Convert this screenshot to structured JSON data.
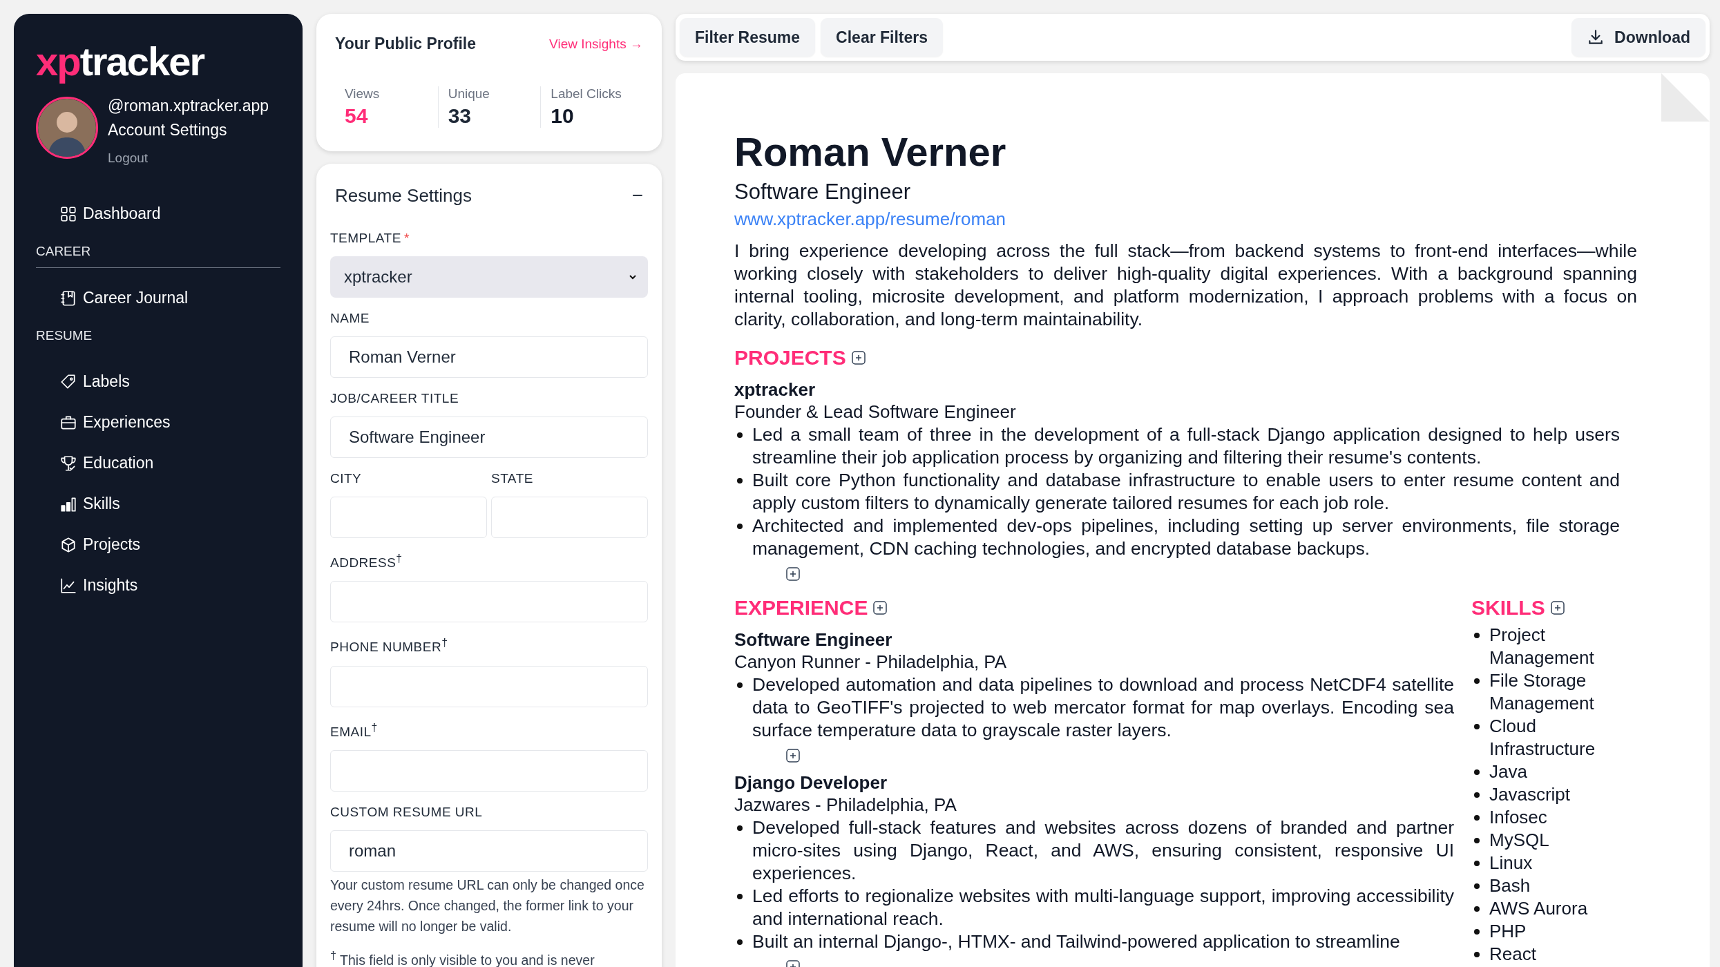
{
  "sidebar": {
    "logo": {
      "accent": "xp",
      "rest": "tracker"
    },
    "profile": {
      "handle": "@roman.xptracker.app",
      "settings_link": "Account Settings",
      "logout": "Logout"
    },
    "nav": [
      {
        "kind": "item",
        "label": "Dashboard"
      },
      {
        "kind": "heading",
        "label": "CAREER",
        "divider": true
      },
      {
        "kind": "item",
        "label": "Career Journal"
      },
      {
        "kind": "heading",
        "label": "RESUME",
        "divider": false
      },
      {
        "kind": "item",
        "label": "Labels"
      },
      {
        "kind": "item",
        "label": "Experiences"
      },
      {
        "kind": "item",
        "label": "Education"
      },
      {
        "kind": "item",
        "label": "Skills"
      },
      {
        "kind": "item",
        "label": "Projects"
      },
      {
        "kind": "item",
        "label": "Insights"
      }
    ]
  },
  "profile_card": {
    "title": "Your Public Profile",
    "link": "View Insights →",
    "stats": [
      {
        "label": "Views",
        "value": "54",
        "color": "#ff2d78"
      },
      {
        "label": "Unique",
        "value": "33",
        "color": "#1f2937"
      },
      {
        "label": "Label Clicks",
        "value": "10",
        "color": "#111827"
      }
    ]
  },
  "resume_settings": {
    "title": "Resume Settings",
    "collapse_symbol": "−",
    "required_symbol": "*",
    "fields": [
      {
        "kind": "select",
        "label": "TEMPLATE",
        "required": true,
        "value": "xptracker"
      },
      {
        "kind": "text",
        "label": "NAME",
        "required": false,
        "value": "Roman Verner"
      },
      {
        "kind": "text",
        "label": "JOB/CAREER TITLE",
        "required": false,
        "value": "Software Engineer"
      },
      {
        "kind": "pair",
        "fields": [
          {
            "label": "CITY",
            "required": false
          },
          {
            "label": "STATE",
            "required": false
          }
        ]
      },
      {
        "kind": "text",
        "label": "ADDRESS$^{†}$",
        "required": false
      },
      {
        "kind": "text",
        "label": "PHONE NUMBER$^{†}$",
        "required": false
      },
      {
        "kind": "text",
        "label": "EMAIL$^{†}$",
        "required": false
      },
      {
        "kind": "text",
        "label": "CUSTOM RESUME URL",
        "required": false,
        "value": "roman",
        "help": "Your custom resume URL can only be changed once every 24hrs. Once changed, the former link to your resume will no longer be valid."
      }
    ],
    "footnote": "$^{†}$ This field is only visible to you and is never"
  },
  "toolbar": {
    "buttons": [
      {
        "label": "Filter Resume"
      },
      {
        "label": "Clear Filters"
      }
    ],
    "download": "Download"
  },
  "resume": {
    "name": "Roman Verner",
    "title": "Software Engineer",
    "url": "www.xptracker.app/resume/roman",
    "summary": "I bring experience developing across the full stack—from backend systems to front-end interfaces—while working closely with stakeholders to deliver high-quality digital experiences. With a background spanning internal tooling, microsite development, and platform modernization, I approach problems with a focus on clarity, collaboration, and long-term maintainability.",
    "projects": {
      "heading": "PROJECTS",
      "entries": [
        {
          "name": "xptracker",
          "subtitle": "Founder & Lead Software Engineer",
          "bullets": [
            "Led a small team of three in the development of a full-stack Django application designed to help users streamline their job application process by organizing and filtering their resume's contents.",
            "Built core Python functionality and database infrastructure to enable users to enter resume content and apply custom filters to dynamically generate tailored resumes for each job role.",
            "Architected and implemented dev-ops pipelines, including setting up server environments, file storage management, CDN caching technologies, and encrypted database backups."
          ]
        }
      ]
    },
    "experience": {
      "heading": "EXPERIENCE",
      "entries": [
        {
          "name": "Software Engineer",
          "subtitle": "Canyon Runner - Philadelphia, PA",
          "bullets": [
            "Developed automation and data pipelines to download and process NetCDF4 satellite data to GeoTIFF's projected to web mercator format for map overlays. Encoding sea surface temperature data to grayscale raster layers."
          ]
        },
        {
          "name": "Django Developer",
          "subtitle": "Jazwares - Philadelphia, PA",
          "bullets": [
            "Developed full-stack features and websites across dozens of branded and partner micro-sites using Django, React, and AWS, ensuring consistent, responsive UI experiences.",
            "Led efforts to regionalize websites with multi-language support, improving accessibility and international reach.",
            "Built an internal Django-, HTMX- and Tailwind-powered application to streamline"
          ]
        }
      ]
    },
    "skills": {
      "heading": "SKILLS",
      "items": [
        "Project Management",
        "File Storage Management",
        "Cloud Infrastructure",
        "Java",
        "Javascript",
        "Infosec",
        "MySQL",
        "Linux",
        "Bash",
        "AWS Aurora",
        "PHP",
        "React"
      ]
    }
  }
}
